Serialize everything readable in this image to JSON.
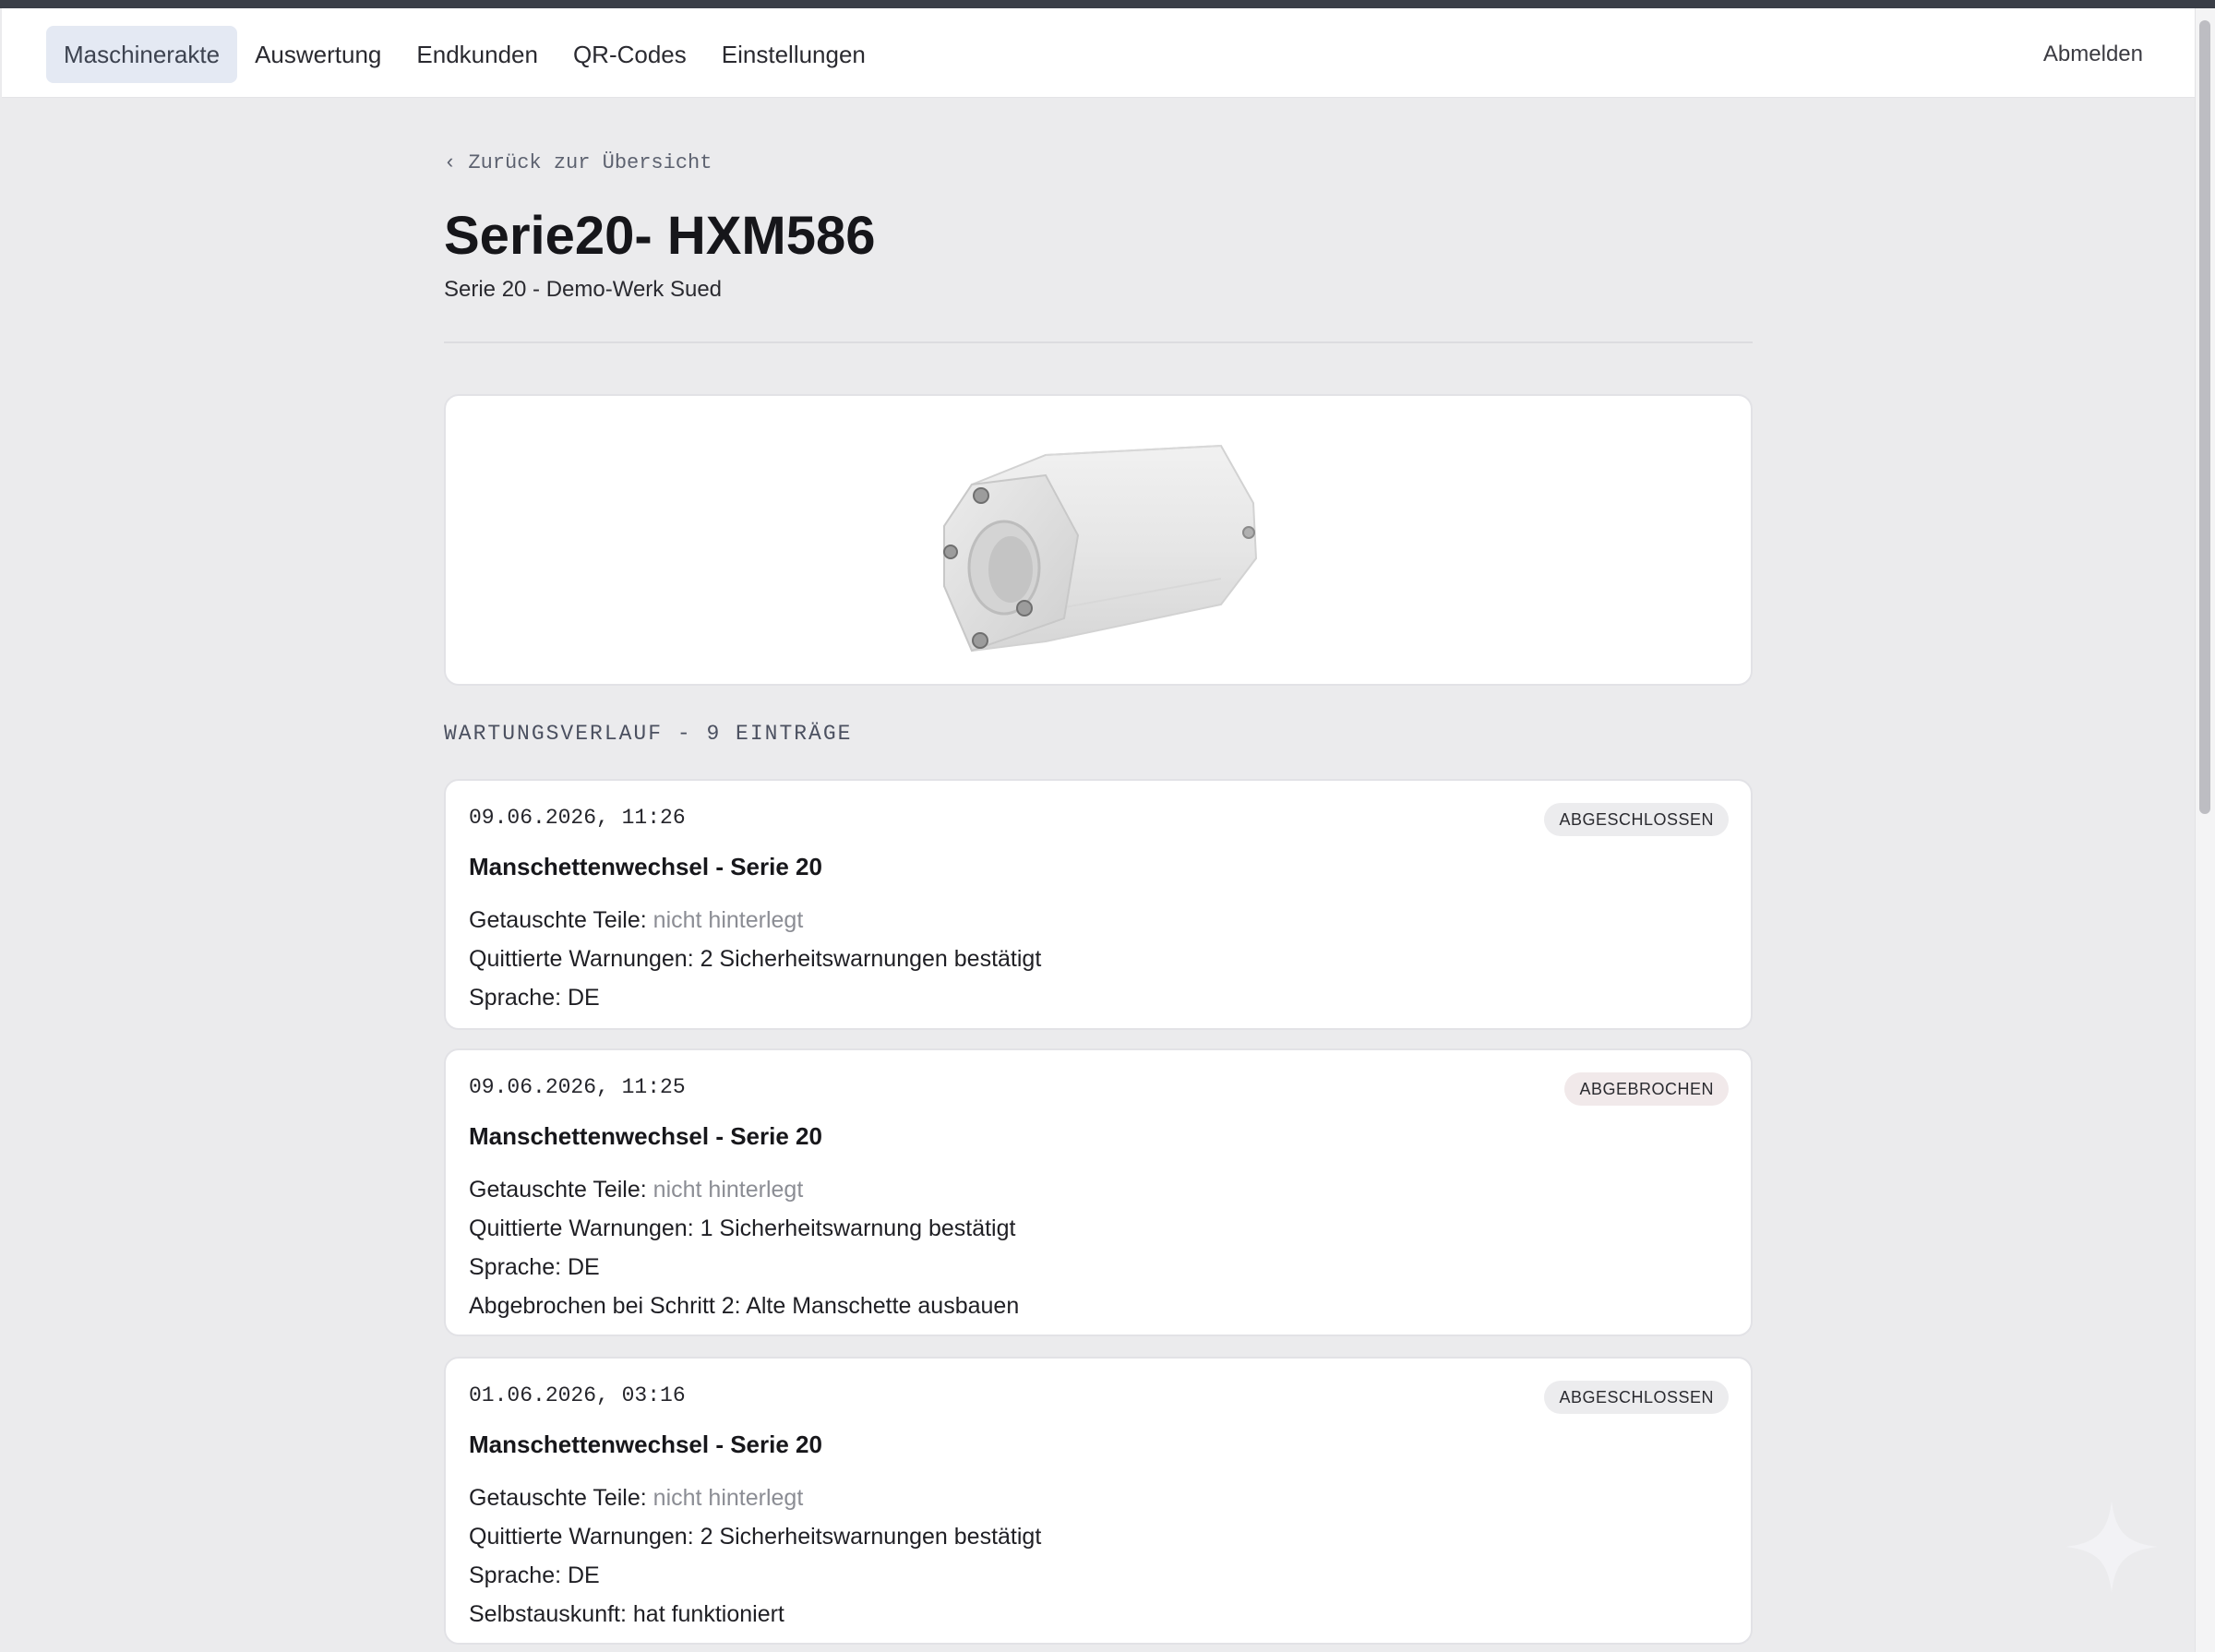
{
  "nav": {
    "items": [
      {
        "label": "Maschinerakte",
        "active": true
      },
      {
        "label": "Auswertung",
        "active": false
      },
      {
        "label": "Endkunden",
        "active": false
      },
      {
        "label": "QR-Codes",
        "active": false
      },
      {
        "label": "Einstellungen",
        "active": false
      }
    ],
    "logout": "Abmelden"
  },
  "page": {
    "back_link": "‹ Zurück zur Übersicht",
    "title": "Serie20- HXM586",
    "subtitle": "Serie 20 - Demo-Werk Sued"
  },
  "history": {
    "heading": "WARTUNGSVERLAUF - 9 EINTRÄGE",
    "entries": [
      {
        "date": "09.06.2026, 11:26",
        "status": "ABGESCHLOSSEN",
        "title": "Manschettenwechsel - Serie 20",
        "parts_label": "Getauschte Teile:",
        "parts_value": "nicht hinterlegt",
        "warnings": "Quittierte Warnungen: 2 Sicherheitswarnungen bestätigt",
        "language": "Sprache: DE"
      },
      {
        "date": "09.06.2026, 11:25",
        "status": "ABGEBROCHEN",
        "title": "Manschettenwechsel - Serie 20",
        "parts_label": "Getauschte Teile:",
        "parts_value": "nicht hinterlegt",
        "warnings": "Quittierte Warnungen: 1 Sicherheitswarnung bestätigt",
        "language": "Sprache: DE",
        "extra": "Abgebrochen bei Schritt 2: Alte Manschette ausbauen"
      },
      {
        "date": "01.06.2026, 03:16",
        "status": "ABGESCHLOSSEN",
        "title": "Manschettenwechsel - Serie 20",
        "parts_label": "Getauschte Teile:",
        "parts_value": "nicht hinterlegt",
        "warnings": "Quittierte Warnungen: 2 Sicherheitswarnungen bestätigt",
        "language": "Sprache: DE",
        "extra": "Selbstauskunft: hat funktioniert"
      }
    ]
  },
  "colors": {
    "page_background": "#ebebed",
    "active_nav": "#e4e9f3",
    "badge_done": "#ececee",
    "badge_aborted": "#f1e9ea",
    "muted_text": "#8b8d94"
  },
  "icons": {
    "back": "chevron-left-icon",
    "assistant": "sparkle-icon"
  }
}
